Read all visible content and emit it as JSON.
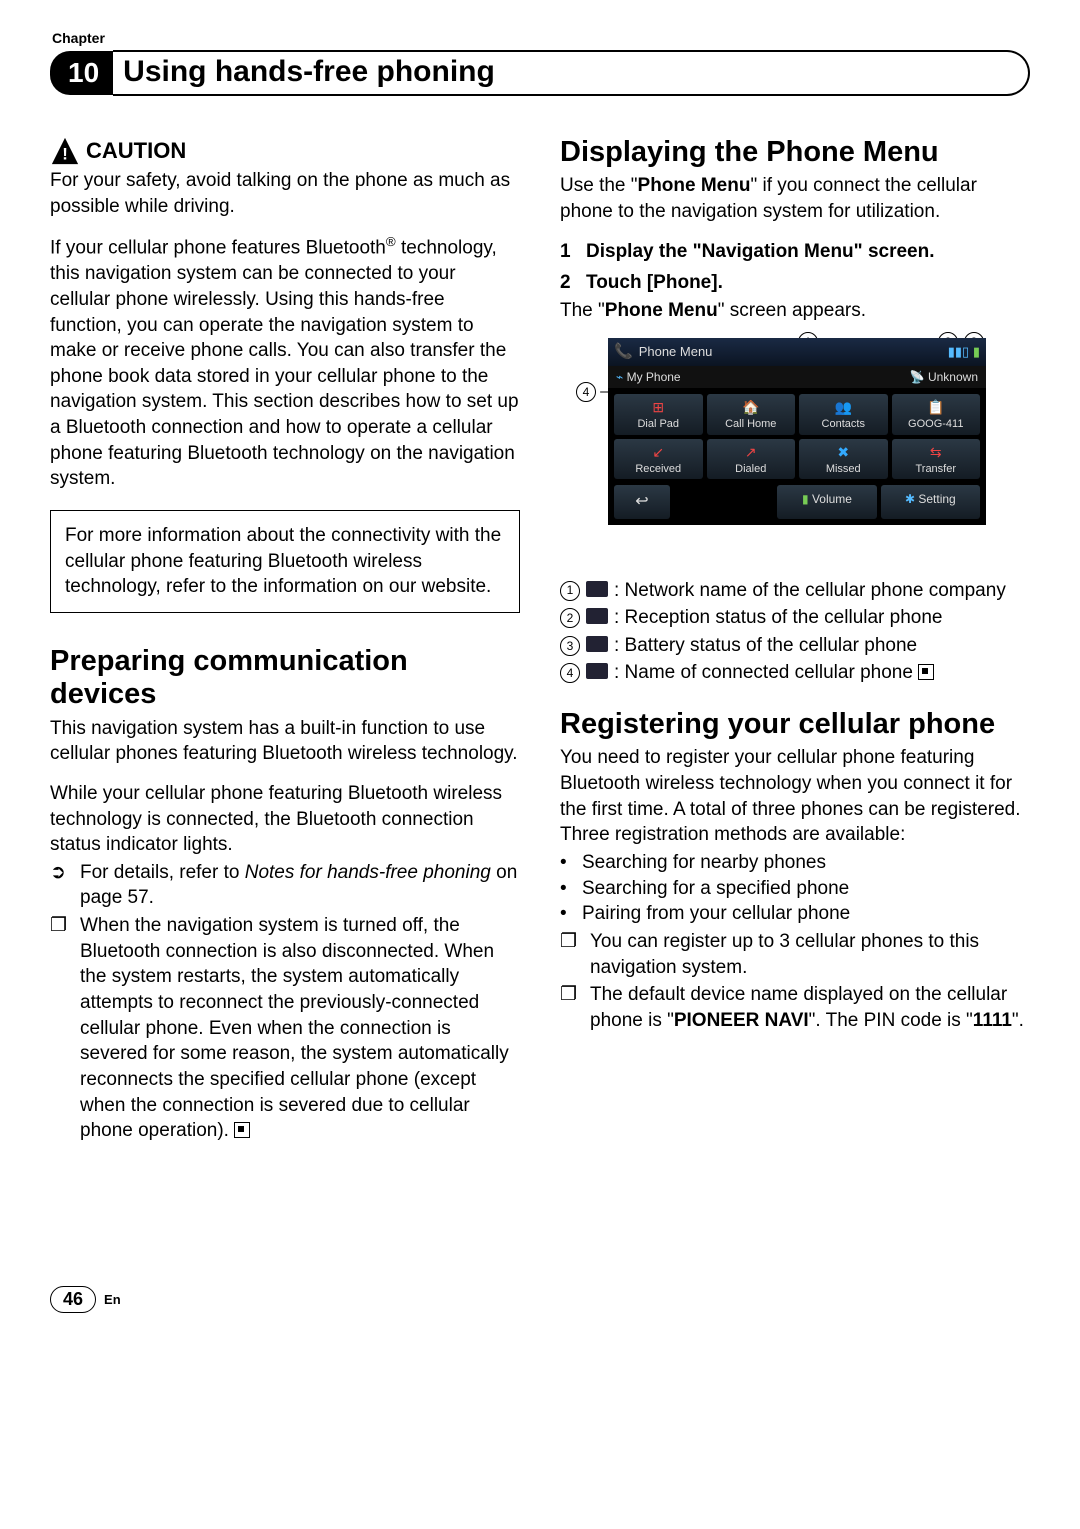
{
  "chapterLabel": "Chapter",
  "chapterNumber": "10",
  "chapterTitle": "Using hands-free phoning",
  "col1": {
    "cautionLabel": "CAUTION",
    "cautionText": "For your safety, avoid talking on the phone as much as possible while driving.",
    "introPre": "If your cellular phone features Bluetooth",
    "introSup": "®",
    "introRest": " technology, this navigation system can be connected to your cellular phone wirelessly. Using this hands-free function, you can operate the navigation system to make or receive phone calls. You can also transfer the phone book data stored in your cellular phone to the navigation system. This section describes how to set up a Bluetooth connection and how to operate a cellular phone featuring Bluetooth technology on the navigation system.",
    "infoBox": "For more information about the connectivity with the cellular phone featuring Bluetooth wireless technology, refer to the information on our website.",
    "section1Title": "Preparing communication devices",
    "section1Para1": "This navigation system has a built-in function to use cellular phones featuring Bluetooth wireless technology.",
    "section1Para2": "While your cellular phone featuring Bluetooth wireless technology is connected, the Bluetooth connection status indicator lights.",
    "section1Ref1a": "For details, refer to ",
    "section1Ref1b": "Notes for hands-free phoning",
    "section1Ref1c": " on page 57.",
    "section1Note1": "When the navigation system is turned off, the Bluetooth connection is also disconnected. When the system restarts, the system automatically attempts to reconnect the previously-connected cellular phone. Even when the connection is severed for some reason, the system automatically reconnects the specified cellular phone (except when the connection is severed due to cellular phone operation)."
  },
  "col2": {
    "section2Title": "Displaying the Phone Menu",
    "section2IntroA": "Use the \"",
    "section2IntroB": "Phone Menu",
    "section2IntroC": "\" if you connect the cellular phone to the navigation system for utilization.",
    "step1": "Display the \"Navigation Menu\" screen.",
    "step2": "Touch [Phone].",
    "step2Sub1": "The \"",
    "step2Sub2": "Phone Menu",
    "step2Sub3": "\" screen appears.",
    "screen": {
      "title": "Phone Menu",
      "device": "My Phone",
      "network": "Unknown",
      "btns": [
        "Dial Pad",
        "Call Home",
        "Contacts",
        "GOOG-411",
        "Received",
        "Dialed",
        "Missed",
        "Transfer"
      ],
      "bottom": [
        "Volume",
        "Setting"
      ]
    },
    "legend": [
      ": Network name of the cellular phone company",
      ": Reception status of the cellular phone",
      ": Battery status of the cellular phone",
      ": Name of connected cellular phone"
    ],
    "section3Title": "Registering your cellular phone",
    "section3Intro": "You need to register your cellular phone featuring Bluetooth wireless technology when you connect it for the first time. A total of three phones can be registered. Three registration methods are available:",
    "section3Bullets": [
      "Searching for nearby phones",
      "Searching for a specified phone",
      "Pairing from your cellular phone"
    ],
    "section3Note1": "You can register up to 3 cellular phones to this navigation system.",
    "section3Note2a": "The default device name displayed on the cellular phone is \"",
    "section3Note2b": "PIONEER NAVI",
    "section3Note2c": "\". The PIN code is \"",
    "section3Note2d": "1111",
    "section3Note2e": "\"."
  },
  "footer": {
    "page": "46",
    "lang": "En"
  }
}
